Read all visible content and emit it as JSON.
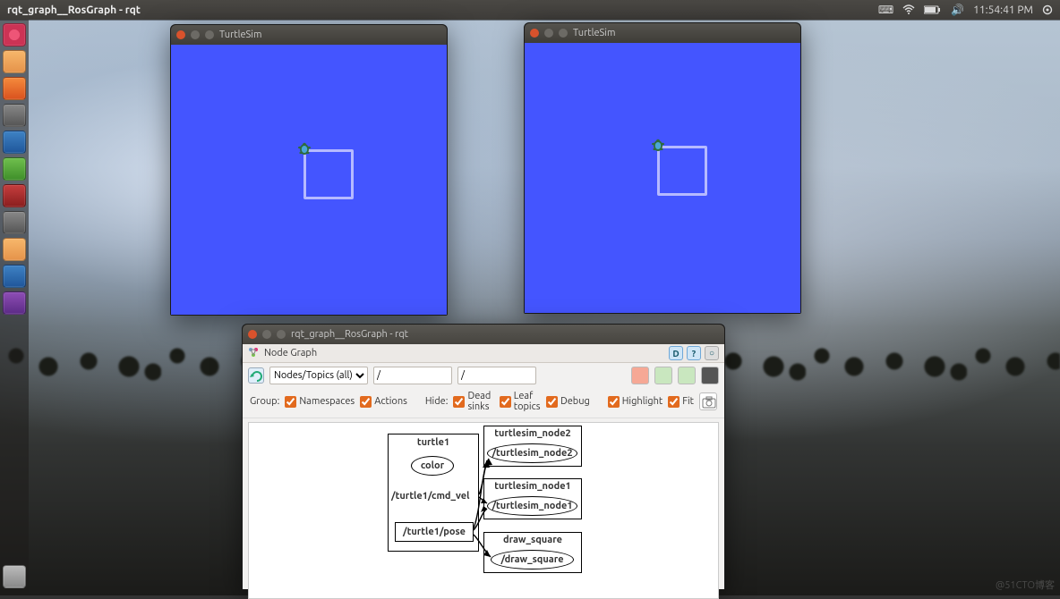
{
  "menubar": {
    "title": "rqt_graph__RosGraph - rqt",
    "clock": "11:54:41 PM"
  },
  "turtlesim": {
    "title": "TurtleSim"
  },
  "rqt": {
    "title": "rqt_graph__RosGraph - rqt",
    "subtitle": "Node Graph",
    "dropdown": "Nodes/Topics (all)",
    "filter1": "/",
    "filter2": "/",
    "group_label": "Group:",
    "namespaces": "Namespaces",
    "actions": "Actions",
    "hide_label": "Hide:",
    "deadsinks": "Dead sinks",
    "leaftopics": "Leaf topics",
    "debug": "Debug",
    "highlight": "Highlight",
    "fit": "Fit"
  },
  "graph": {
    "turtle1": "turtle1",
    "color": "color",
    "cmd_vel": "/turtle1/cmd_vel",
    "pose": "/turtle1/pose",
    "ts_node2": "turtlesim_node2",
    "ts_node2_t": "/turtlesim_node2",
    "ts_node1": "turtlesim_node1",
    "ts_node1_t": "/turtlesim_node1",
    "draw": "draw_square",
    "draw_t": "/draw_square"
  },
  "watermark": "@51CTO博客"
}
